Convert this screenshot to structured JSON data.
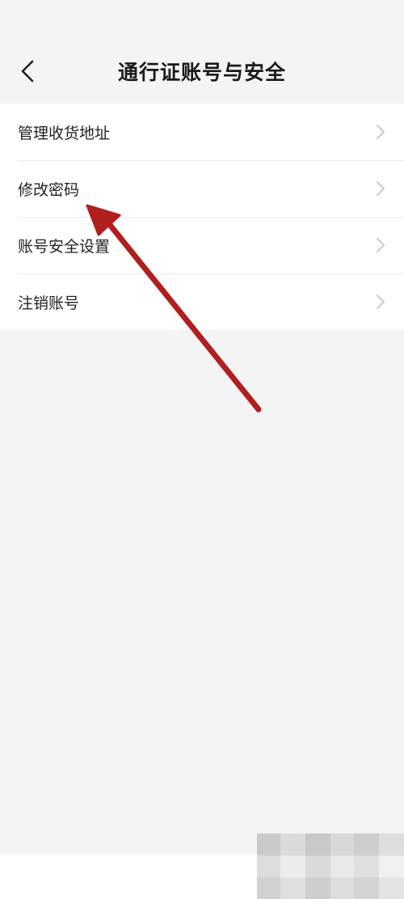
{
  "header": {
    "title": "通行证账号与安全",
    "back_icon": "chevron-left-icon"
  },
  "settings": {
    "items": [
      {
        "label": "管理收货地址",
        "icon": "chevron-right-icon"
      },
      {
        "label": "修改密码",
        "icon": "chevron-right-icon"
      },
      {
        "label": "账号安全设置",
        "icon": "chevron-right-icon"
      },
      {
        "label": "注销账号",
        "icon": "chevron-right-icon"
      }
    ]
  },
  "colors": {
    "background": "#f4f4f4",
    "list_background": "#ffffff",
    "text": "#222222",
    "chevron": "#c4c4c4",
    "annotation_arrow": "#b01e1e"
  }
}
